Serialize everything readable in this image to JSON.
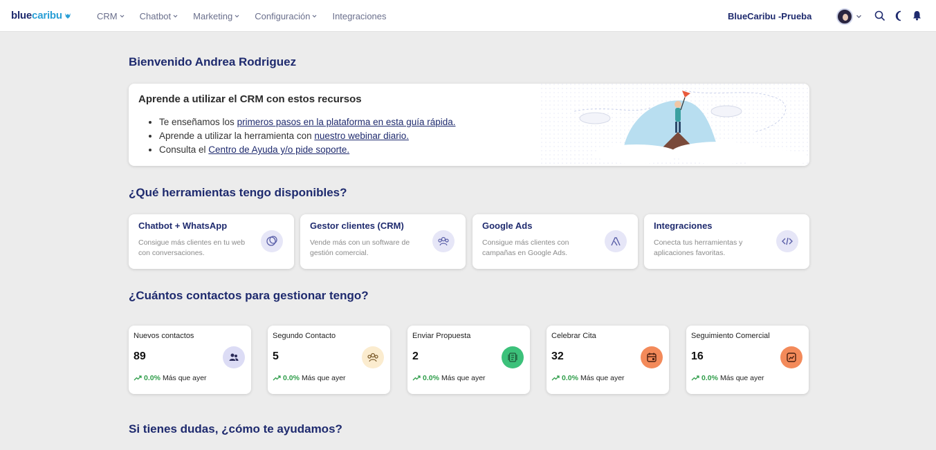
{
  "brand": {
    "part1": "blue",
    "part2": "caribu"
  },
  "nav": [
    {
      "label": "CRM"
    },
    {
      "label": "Chatbot"
    },
    {
      "label": "Marketing"
    },
    {
      "label": "Configuración"
    },
    {
      "label": "Integraciones"
    }
  ],
  "account_name": "BlueCaribu -Prueba",
  "welcome": "Bienvenido Andrea Rodriguez",
  "resources": {
    "title": "Aprende a utilizar el CRM con estos recursos",
    "items": [
      {
        "prefix": "Te enseñamos los ",
        "link": "primeros pasos en la plataforma en esta guía rápida."
      },
      {
        "prefix": "Aprende a utilizar la herramienta con ",
        "link": "nuestro webinar diario."
      },
      {
        "prefix": "Consulta el ",
        "link": "Centro de Ayuda y/o pide soporte."
      }
    ]
  },
  "tools_heading": "¿Qué herramientas tengo disponibles?",
  "tools": [
    {
      "title": "Chatbot + WhatsApp",
      "desc": "Consigue más clientes en tu web con conversaciones.",
      "icon": "chat-icon"
    },
    {
      "title": "Gestor clientes (CRM)",
      "desc": "Vende más con un software de gestión comercial.",
      "icon": "users-icon"
    },
    {
      "title": "Google Ads",
      "desc": "Consigue más clientes con campañas en Google Ads.",
      "icon": "google-ads-icon"
    },
    {
      "title": "Integraciones",
      "desc": "Conecta tus herramientas y aplicaciones favoritas.",
      "icon": "code-icon"
    }
  ],
  "contacts_heading": "¿Cuántos contactos para gestionar tengo?",
  "stats": [
    {
      "label": "Nuevos contactos",
      "value": "89",
      "pct": "0.0%",
      "suffix": "Más que ayer",
      "color": "#dcdcf5"
    },
    {
      "label": "Segundo Contacto",
      "value": "5",
      "pct": "0.0%",
      "suffix": "Más que ayer",
      "color": "#fbeccf"
    },
    {
      "label": "Enviar Propuesta",
      "value": "2",
      "pct": "0.0%",
      "suffix": "Más que ayer",
      "color": "#3cc17a"
    },
    {
      "label": "Celebrar Cita",
      "value": "32",
      "pct": "0.0%",
      "suffix": "Más que ayer",
      "color": "#f38a5a"
    },
    {
      "label": "Seguimiento Comercial",
      "value": "16",
      "pct": "0.0%",
      "suffix": "Más que ayer",
      "color": "#f38a5a"
    }
  ],
  "help_heading": "Si tienes dudas, ¿cómo te ayudamos?"
}
